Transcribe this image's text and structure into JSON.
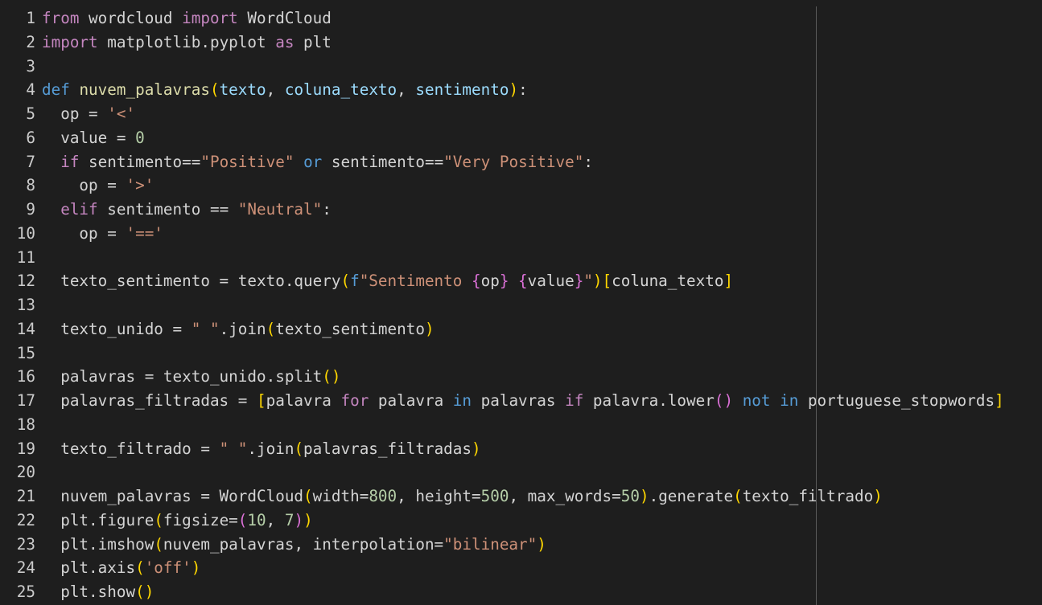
{
  "colors": {
    "background": "#1e1e1e",
    "line_number": "#cccccc",
    "plain": "#d4d4d4",
    "keyword_control": "#c586c0",
    "keyword_def": "#569cd6",
    "function": "#dcdcaa",
    "parameter": "#9cdcfe",
    "string": "#ce9178",
    "number": "#b5cea8",
    "bracket_1": "#ffd700",
    "bracket_2": "#da70d6",
    "bracket_3": "#179fff",
    "ruler": "#5a5a5a"
  },
  "editor": {
    "language": "python",
    "lines": [
      {
        "num": "1",
        "tokens": [
          [
            "from",
            "keyword_control"
          ],
          [
            " wordcloud ",
            "plain"
          ],
          [
            "import",
            "keyword_control"
          ],
          [
            " WordCloud",
            "plain"
          ]
        ]
      },
      {
        "num": "2",
        "tokens": [
          [
            "import",
            "keyword_control"
          ],
          [
            " matplotlib.pyplot ",
            "plain"
          ],
          [
            "as",
            "keyword_control"
          ],
          [
            " plt",
            "plain"
          ]
        ]
      },
      {
        "num": "3",
        "tokens": []
      },
      {
        "num": "4",
        "tokens": [
          [
            "def",
            "keyword_def"
          ],
          [
            " ",
            "plain"
          ],
          [
            "nuvem_palavras",
            "function"
          ],
          [
            "(",
            "bracket_1"
          ],
          [
            "texto",
            "parameter"
          ],
          [
            ", ",
            "plain"
          ],
          [
            "coluna_texto",
            "parameter"
          ],
          [
            ", ",
            "plain"
          ],
          [
            "sentimento",
            "parameter"
          ],
          [
            ")",
            "bracket_1"
          ],
          [
            ":",
            "plain"
          ]
        ]
      },
      {
        "num": "5",
        "tokens": [
          [
            "  op = ",
            "plain"
          ],
          [
            "'<'",
            "string"
          ]
        ]
      },
      {
        "num": "6",
        "tokens": [
          [
            "  value = ",
            "plain"
          ],
          [
            "0",
            "number"
          ]
        ]
      },
      {
        "num": "7",
        "tokens": [
          [
            "  ",
            "plain"
          ],
          [
            "if",
            "keyword_control"
          ],
          [
            " sentimento==",
            "plain"
          ],
          [
            "\"Positive\"",
            "string"
          ],
          [
            " ",
            "plain"
          ],
          [
            "or",
            "keyword_def"
          ],
          [
            " sentimento==",
            "plain"
          ],
          [
            "\"Very Positive\"",
            "string"
          ],
          [
            ":",
            "plain"
          ]
        ]
      },
      {
        "num": "8",
        "tokens": [
          [
            "    op = ",
            "plain"
          ],
          [
            "'>'",
            "string"
          ]
        ]
      },
      {
        "num": "9",
        "tokens": [
          [
            "  ",
            "plain"
          ],
          [
            "elif",
            "keyword_control"
          ],
          [
            " sentimento == ",
            "plain"
          ],
          [
            "\"Neutral\"",
            "string"
          ],
          [
            ":",
            "plain"
          ]
        ]
      },
      {
        "num": "10",
        "tokens": [
          [
            "    op = ",
            "plain"
          ],
          [
            "'=='",
            "string"
          ]
        ]
      },
      {
        "num": "11",
        "tokens": []
      },
      {
        "num": "12",
        "tokens": [
          [
            "  texto_sentimento = texto.query",
            "plain"
          ],
          [
            "(",
            "bracket_1"
          ],
          [
            "f",
            "keyword_def"
          ],
          [
            "\"Sentimento ",
            "string"
          ],
          [
            "{",
            "bracket_2"
          ],
          [
            "op",
            "plain"
          ],
          [
            "}",
            "bracket_2"
          ],
          [
            " ",
            "string"
          ],
          [
            "{",
            "bracket_2"
          ],
          [
            "value",
            "plain"
          ],
          [
            "}",
            "bracket_2"
          ],
          [
            "\"",
            "string"
          ],
          [
            ")",
            "bracket_1"
          ],
          [
            "[",
            "bracket_1"
          ],
          [
            "coluna_texto",
            "plain"
          ],
          [
            "]",
            "bracket_1"
          ]
        ]
      },
      {
        "num": "13",
        "tokens": []
      },
      {
        "num": "14",
        "tokens": [
          [
            "  texto_unido = ",
            "plain"
          ],
          [
            "\" \"",
            "string"
          ],
          [
            ".join",
            "plain"
          ],
          [
            "(",
            "bracket_1"
          ],
          [
            "texto_sentimento",
            "plain"
          ],
          [
            ")",
            "bracket_1"
          ]
        ]
      },
      {
        "num": "15",
        "tokens": []
      },
      {
        "num": "16",
        "tokens": [
          [
            "  palavras = texto_unido.split",
            "plain"
          ],
          [
            "()",
            "bracket_1"
          ]
        ]
      },
      {
        "num": "17",
        "tokens": [
          [
            "  palavras_filtradas = ",
            "plain"
          ],
          [
            "[",
            "bracket_1"
          ],
          [
            "palavra ",
            "plain"
          ],
          [
            "for",
            "keyword_control"
          ],
          [
            " palavra ",
            "plain"
          ],
          [
            "in",
            "keyword_def"
          ],
          [
            " palavras ",
            "plain"
          ],
          [
            "if",
            "keyword_control"
          ],
          [
            " palavra.lower",
            "plain"
          ],
          [
            "()",
            "bracket_2"
          ],
          [
            " ",
            "plain"
          ],
          [
            "not",
            "keyword_def"
          ],
          [
            " ",
            "plain"
          ],
          [
            "in",
            "keyword_def"
          ],
          [
            " portuguese_stopwords",
            "plain"
          ],
          [
            "]",
            "bracket_1"
          ]
        ]
      },
      {
        "num": "18",
        "tokens": []
      },
      {
        "num": "19",
        "tokens": [
          [
            "  texto_filtrado = ",
            "plain"
          ],
          [
            "\" \"",
            "string"
          ],
          [
            ".join",
            "plain"
          ],
          [
            "(",
            "bracket_1"
          ],
          [
            "palavras_filtradas",
            "plain"
          ],
          [
            ")",
            "bracket_1"
          ]
        ]
      },
      {
        "num": "20",
        "tokens": []
      },
      {
        "num": "21",
        "tokens": [
          [
            "  nuvem_palavras = WordCloud",
            "plain"
          ],
          [
            "(",
            "bracket_1"
          ],
          [
            "width=",
            "plain"
          ],
          [
            "800",
            "number"
          ],
          [
            ", height=",
            "plain"
          ],
          [
            "500",
            "number"
          ],
          [
            ", max_words=",
            "plain"
          ],
          [
            "50",
            "number"
          ],
          [
            ")",
            "bracket_1"
          ],
          [
            ".generate",
            "plain"
          ],
          [
            "(",
            "bracket_1"
          ],
          [
            "texto_filtrado",
            "plain"
          ],
          [
            ")",
            "bracket_1"
          ]
        ]
      },
      {
        "num": "22",
        "tokens": [
          [
            "  plt.figure",
            "plain"
          ],
          [
            "(",
            "bracket_1"
          ],
          [
            "figsize=",
            "plain"
          ],
          [
            "(",
            "bracket_2"
          ],
          [
            "10",
            "number"
          ],
          [
            ", ",
            "plain"
          ],
          [
            "7",
            "number"
          ],
          [
            ")",
            "bracket_2"
          ],
          [
            ")",
            "bracket_1"
          ]
        ]
      },
      {
        "num": "23",
        "tokens": [
          [
            "  plt.imshow",
            "plain"
          ],
          [
            "(",
            "bracket_1"
          ],
          [
            "nuvem_palavras, interpolation=",
            "plain"
          ],
          [
            "\"bilinear\"",
            "string"
          ],
          [
            ")",
            "bracket_1"
          ]
        ]
      },
      {
        "num": "24",
        "tokens": [
          [
            "  plt.axis",
            "plain"
          ],
          [
            "(",
            "bracket_1"
          ],
          [
            "'off'",
            "string"
          ],
          [
            ")",
            "bracket_1"
          ]
        ]
      },
      {
        "num": "25",
        "tokens": [
          [
            "  plt.show",
            "plain"
          ],
          [
            "()",
            "bracket_1"
          ]
        ]
      }
    ]
  }
}
